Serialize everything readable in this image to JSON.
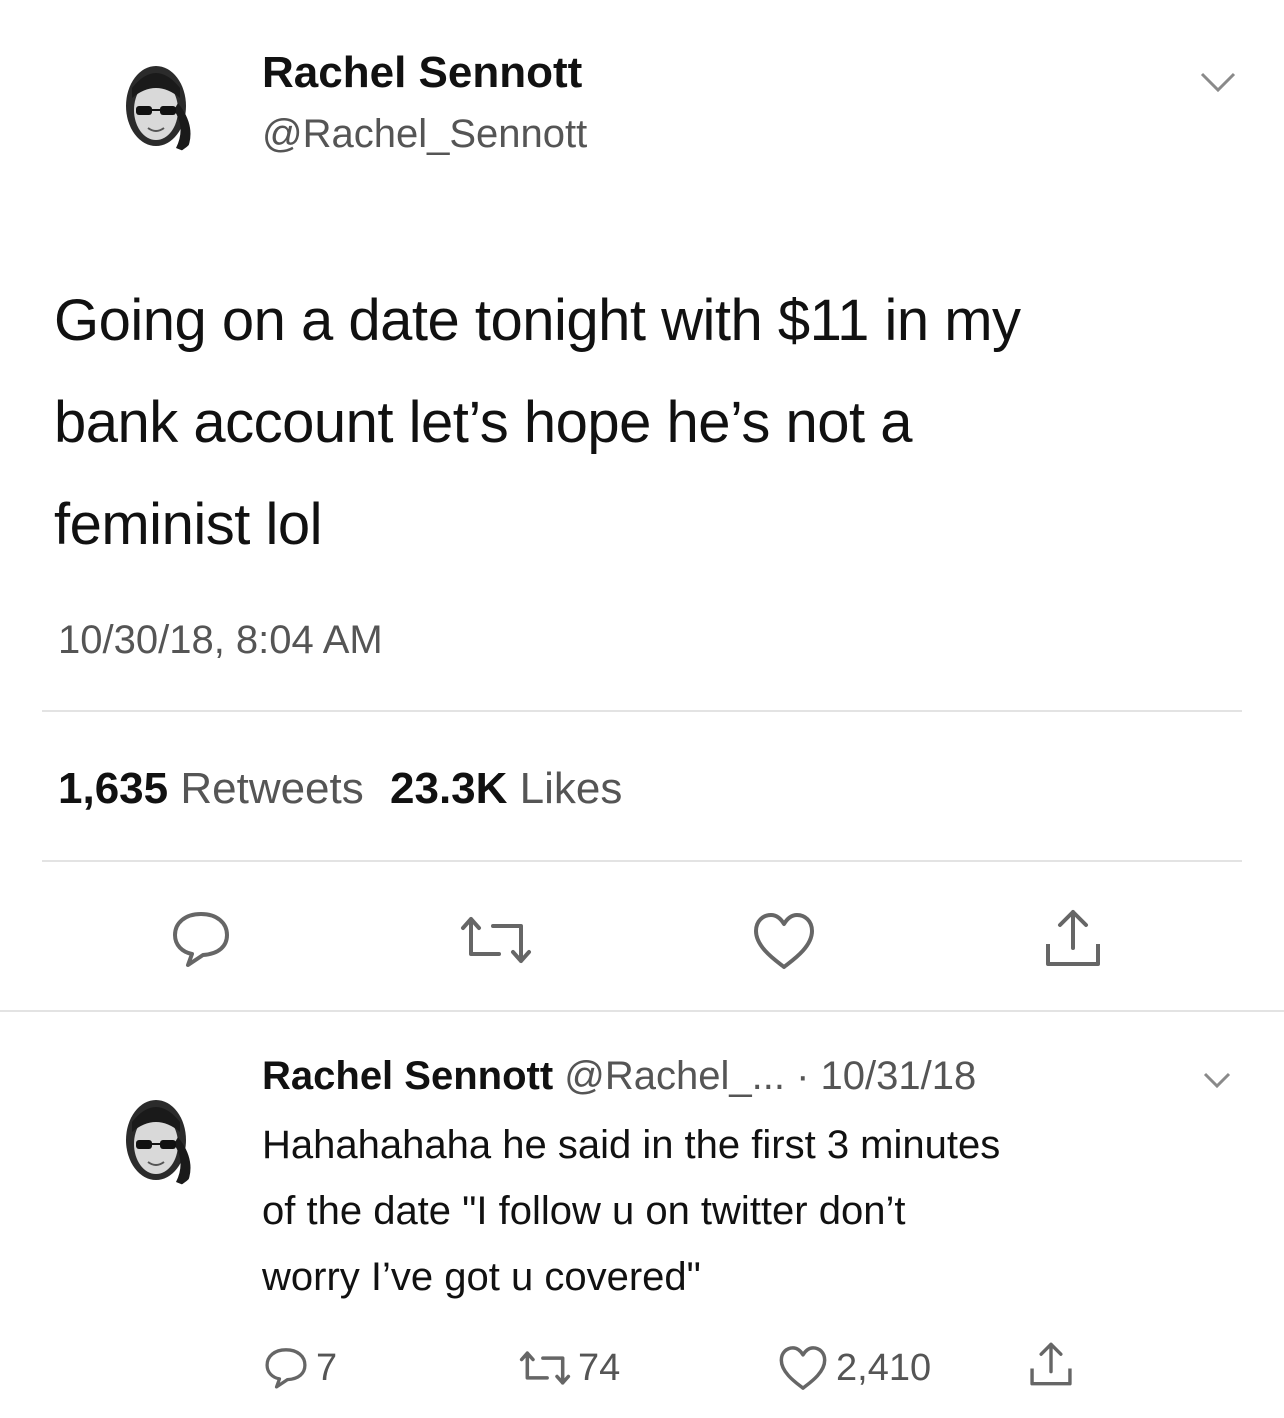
{
  "tweet": {
    "display_name": "Rachel Sennott",
    "handle": "@Rachel_Sennott",
    "text_lines": [
      "Going on a date tonight with $11 in my",
      "bank account let’s hope he’s not a",
      "feminist lol"
    ],
    "timestamp": "10/30/18, 8:04 AM",
    "retweets_count": "1,635",
    "retweets_label": "Retweets",
    "likes_count": "23.3K",
    "likes_label": "Likes",
    "icons": [
      "chevron-down-icon",
      "reply-icon",
      "retweet-icon",
      "like-icon",
      "share-icon"
    ]
  },
  "reply": {
    "display_name": "Rachel Sennott",
    "handle": "@Rachel_...",
    "date": "· 10/31/18",
    "text_lines": [
      "Hahahahaha he said in the first 3 minutes",
      "of the date \"I follow u on twitter don’t",
      "worry I’ve got u covered\""
    ],
    "reply_count": "7",
    "retweet_count": "74",
    "like_count": "2,410"
  }
}
